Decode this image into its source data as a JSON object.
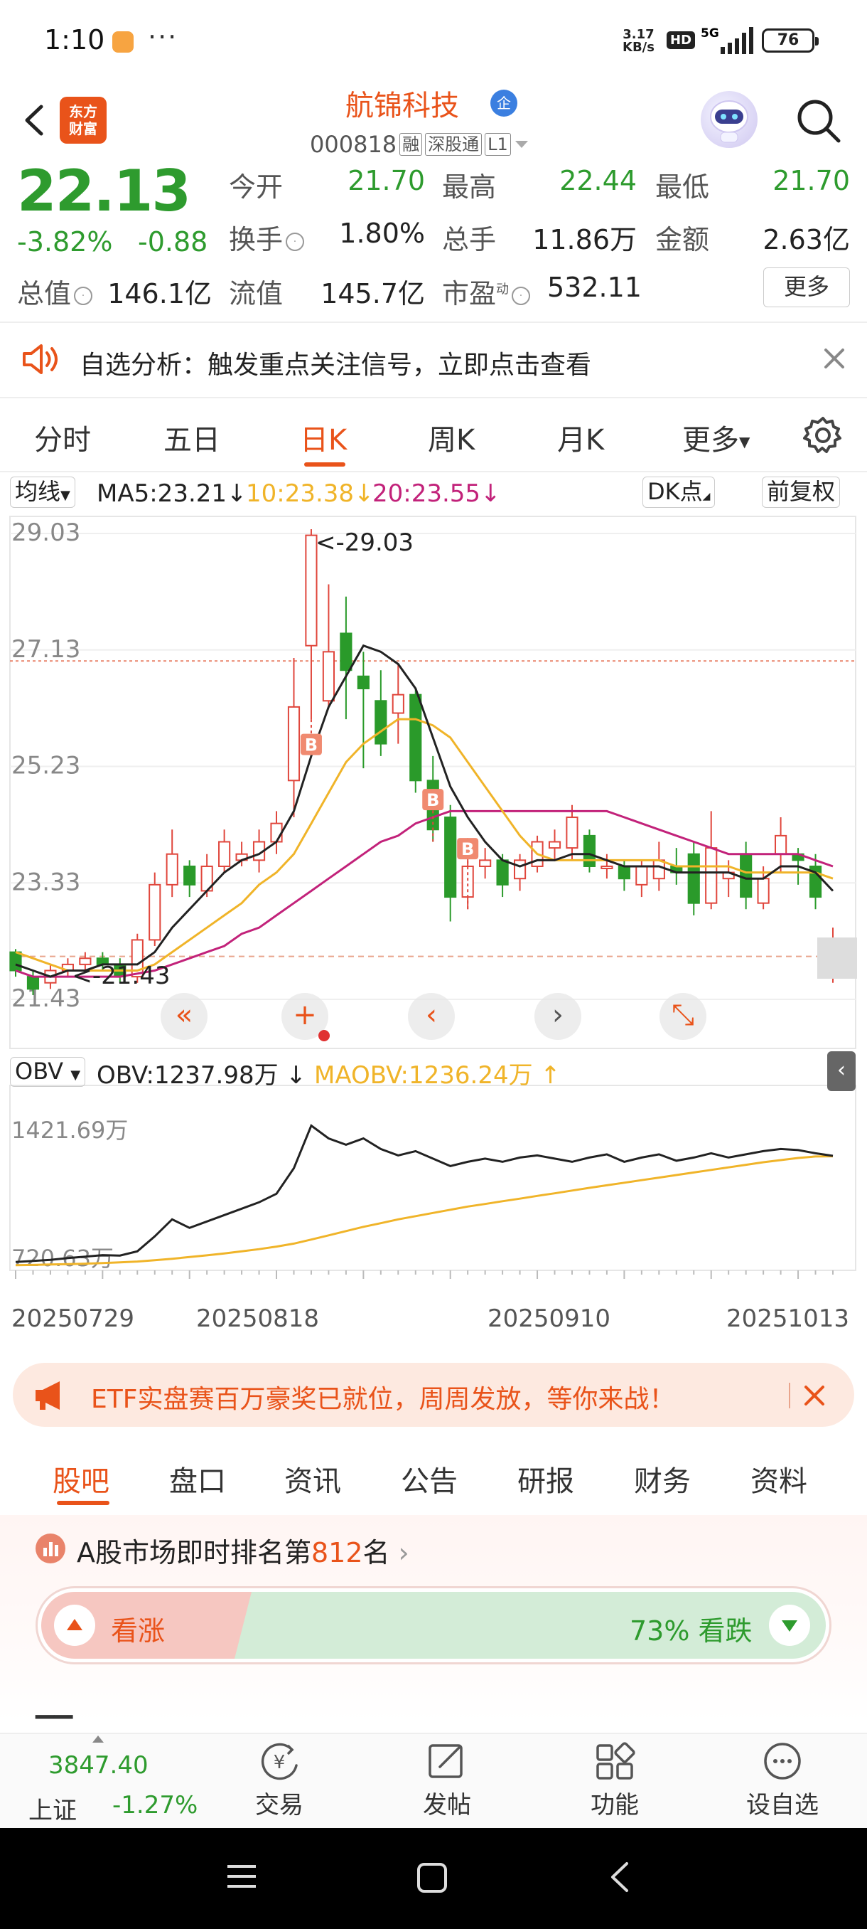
{
  "status_bar": {
    "time": "1:10",
    "dots": "···",
    "speed_top": "3.17",
    "speed_bottom": "KB/s",
    "hd": "HD",
    "network": "5G",
    "battery": "76"
  },
  "header": {
    "logo_line1": "东方",
    "logo_line2": "财富",
    "stock_name": "航锦科技",
    "name_badge": "企",
    "code": "000818",
    "tag_margin": "融",
    "tag_connect": "深股通",
    "tag_level": "L1"
  },
  "quote": {
    "price": "22.13",
    "change_pct": "-3.82%",
    "change_val": "-0.88",
    "open_label": "今开",
    "open": "21.70",
    "high_label": "最高",
    "high": "22.44",
    "low_label": "最低",
    "low": "21.70",
    "turnover_label": "换手",
    "turnover": "1.80%",
    "volume_label": "总手",
    "volume": "11.86万",
    "amount_label": "金额",
    "amount": "2.63亿",
    "mktcap_label": "总值",
    "mktcap": "146.1亿",
    "float_label": "流值",
    "float": "145.7亿",
    "pe_label": "市盈",
    "pe_sup": "动",
    "pe": "532.11",
    "more": "更多"
  },
  "alert": {
    "text": "自选分析：触发重点关注信号，立即点击查看"
  },
  "period_tabs": [
    "分时",
    "五日",
    "日K",
    "周K",
    "月K",
    "更多"
  ],
  "ma": {
    "selector": "均线",
    "ma5": "MA5:23.21",
    "ma10": "10:23.38",
    "ma20": "20:23.55",
    "dk": "DK点",
    "adjust": "前复权",
    "colors": {
      "ma5": "#222222",
      "ma10": "#f0b429",
      "ma20": "#c2227a"
    }
  },
  "chart_data": [
    {
      "type": "candlestick",
      "y_ticks": [
        "29.03",
        "27.13",
        "25.23",
        "23.33",
        "21.43"
      ],
      "ylim": [
        21.43,
        29.03
      ],
      "high_marker": "<-29.03",
      "low_marker": "<-21.43",
      "buy_marker": "B",
      "candles": [
        [
          22.2,
          21.9,
          22.25,
          21.8
        ],
        [
          21.8,
          21.6,
          21.9,
          21.5
        ],
        [
          21.7,
          21.9,
          22.0,
          21.6
        ],
        [
          21.9,
          22.0,
          22.1,
          21.8
        ],
        [
          22.0,
          22.1,
          22.2,
          21.9
        ],
        [
          22.1,
          22.0,
          22.2,
          21.9
        ],
        [
          22.0,
          21.8,
          22.1,
          21.7
        ],
        [
          21.8,
          22.4,
          22.5,
          21.7
        ],
        [
          22.4,
          23.3,
          23.5,
          22.3
        ],
        [
          23.3,
          23.8,
          24.2,
          23.1
        ],
        [
          23.6,
          23.3,
          23.7,
          23.1
        ],
        [
          23.2,
          23.6,
          23.8,
          23.1
        ],
        [
          23.6,
          24.0,
          24.2,
          23.5
        ],
        [
          23.7,
          23.8,
          24.0,
          23.6
        ],
        [
          23.7,
          24.0,
          24.2,
          23.5
        ],
        [
          24.0,
          24.3,
          24.5,
          23.8
        ],
        [
          25.0,
          26.2,
          27.0,
          24.4
        ],
        [
          27.2,
          29.0,
          29.1,
          26.0
        ],
        [
          26.3,
          27.1,
          28.2,
          26.2
        ],
        [
          27.4,
          26.8,
          28.0,
          26.0
        ],
        [
          26.7,
          26.5,
          27.1,
          25.2
        ],
        [
          26.3,
          25.6,
          26.8,
          25.4
        ],
        [
          26.1,
          26.4,
          26.9,
          25.6
        ],
        [
          26.4,
          25.0,
          26.5,
          24.8
        ],
        [
          25.0,
          24.2,
          25.4,
          24.0
        ],
        [
          24.4,
          23.1,
          24.6,
          22.7
        ],
        [
          23.1,
          23.6,
          24.0,
          22.9
        ],
        [
          23.6,
          23.7,
          23.9,
          23.4
        ],
        [
          23.7,
          23.3,
          23.8,
          23.1
        ],
        [
          23.4,
          23.7,
          23.8,
          23.2
        ],
        [
          23.6,
          24.0,
          24.1,
          23.5
        ],
        [
          23.9,
          24.0,
          24.2,
          23.7
        ],
        [
          23.9,
          24.4,
          24.6,
          23.7
        ],
        [
          24.1,
          23.6,
          24.2,
          23.5
        ],
        [
          23.6,
          23.6,
          23.8,
          23.4
        ],
        [
          23.6,
          23.4,
          23.7,
          23.2
        ],
        [
          23.3,
          23.6,
          23.7,
          23.1
        ],
        [
          23.4,
          23.7,
          24.0,
          23.2
        ],
        [
          23.6,
          23.5,
          23.9,
          23.3
        ],
        [
          23.8,
          23.0,
          24.0,
          22.8
        ],
        [
          23.0,
          23.9,
          24.5,
          22.9
        ],
        [
          23.4,
          23.5,
          23.7,
          23.1
        ],
        [
          23.8,
          23.1,
          24.0,
          22.9
        ],
        [
          23.0,
          23.4,
          23.6,
          22.9
        ],
        [
          23.8,
          24.1,
          24.4,
          23.5
        ],
        [
          23.8,
          23.7,
          23.9,
          23.3
        ],
        [
          23.6,
          23.1,
          23.8,
          22.9
        ],
        [
          22.0,
          22.3,
          22.6,
          21.7
        ]
      ],
      "ma5": [
        22.0,
        21.9,
        21.8,
        21.9,
        21.9,
        22.0,
        22.0,
        22.0,
        22.2,
        22.6,
        22.9,
        23.2,
        23.5,
        23.7,
        23.8,
        24.0,
        24.5,
        25.4,
        26.2,
        26.7,
        27.2,
        27.1,
        26.9,
        26.5,
        25.7,
        24.9,
        24.4,
        24.0,
        23.7,
        23.6,
        23.7,
        23.7,
        23.8,
        23.8,
        23.7,
        23.6,
        23.6,
        23.6,
        23.5,
        23.5,
        23.5,
        23.5,
        23.4,
        23.4,
        23.6,
        23.6,
        23.5,
        23.2
      ],
      "ma10": [
        22.2,
        22.1,
        22.0,
        21.9,
        21.9,
        21.9,
        21.9,
        21.9,
        22.0,
        22.2,
        22.4,
        22.6,
        22.8,
        23.0,
        23.3,
        23.5,
        23.8,
        24.3,
        24.8,
        25.3,
        25.6,
        25.8,
        26.0,
        26.0,
        25.9,
        25.7,
        25.3,
        24.9,
        24.5,
        24.1,
        23.8,
        23.7,
        23.7,
        23.7,
        23.7,
        23.7,
        23.7,
        23.7,
        23.6,
        23.6,
        23.6,
        23.6,
        23.5,
        23.5,
        23.5,
        23.5,
        23.5,
        23.4
      ],
      "ma20": [
        21.9,
        21.8,
        21.8,
        21.8,
        21.8,
        21.8,
        21.8,
        21.85,
        21.9,
        22.0,
        22.1,
        22.2,
        22.3,
        22.5,
        22.6,
        22.8,
        23.0,
        23.2,
        23.4,
        23.6,
        23.8,
        24.0,
        24.1,
        24.3,
        24.4,
        24.5,
        24.5,
        24.5,
        24.5,
        24.5,
        24.5,
        24.5,
        24.5,
        24.5,
        24.5,
        24.4,
        24.3,
        24.2,
        24.1,
        24.0,
        23.9,
        23.8,
        23.8,
        23.8,
        23.8,
        23.8,
        23.7,
        23.6
      ]
    },
    {
      "type": "line",
      "indicator": "OBV",
      "y_ticks": [
        "1421.69万",
        "720.63万"
      ],
      "ylim": [
        720.63,
        1421.69
      ],
      "obv": [
        740,
        745,
        750,
        758,
        765,
        772,
        770,
        790,
        860,
        940,
        900,
        930,
        960,
        990,
        1020,
        1060,
        1180,
        1380,
        1320,
        1290,
        1320,
        1270,
        1240,
        1260,
        1225,
        1190,
        1210,
        1225,
        1210,
        1230,
        1240,
        1225,
        1210,
        1230,
        1245,
        1210,
        1230,
        1245,
        1215,
        1230,
        1250,
        1230,
        1245,
        1260,
        1270,
        1265,
        1250,
        1238
      ],
      "maobv": [
        725,
        726,
        728,
        730,
        732,
        735,
        738,
        742,
        748,
        755,
        763,
        771,
        780,
        790,
        800,
        812,
        826,
        845,
        865,
        885,
        905,
        922,
        940,
        955,
        970,
        985,
        1000,
        1012,
        1025,
        1037,
        1050,
        1062,
        1075,
        1088,
        1100,
        1112,
        1124,
        1136,
        1148,
        1160,
        1172,
        1184,
        1196,
        1208,
        1218,
        1228,
        1235,
        1236
      ],
      "x_labels": [
        "20250729",
        "20250818",
        "20250910",
        "20251013"
      ]
    }
  ],
  "obv": {
    "selector": "OBV",
    "obv_value": "OBV:1237.98万",
    "maobv_value": "MAOBV:1236.24万"
  },
  "etf_banner": {
    "text": "ETF实盘赛百万豪奖已就位，周周发放，等你来战！"
  },
  "section_tabs": [
    "股吧",
    "盘口",
    "资讯",
    "公告",
    "研报",
    "财务",
    "资料"
  ],
  "rank": {
    "prefix": "A股市场即时排名第",
    "number": "812",
    "suffix": "名"
  },
  "vote": {
    "up_label": "看涨",
    "down_label": "73% 看跌"
  },
  "bottom_nav": {
    "index_value": "3847.40",
    "index_name": "上证",
    "index_pct": "-1.27%",
    "trade": "交易",
    "post": "发帖",
    "func": "功能",
    "watch": "设自选"
  }
}
